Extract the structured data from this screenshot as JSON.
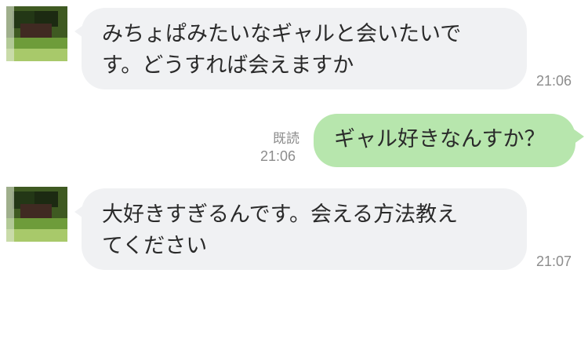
{
  "messages": [
    {
      "side": "incoming",
      "lines": [
        "みちょぱみたいなギャルと会いたいで",
        "す。どうすれば会えますか"
      ],
      "time": "21:06"
    },
    {
      "side": "outgoing",
      "text": "ギャル好きなんすか？",
      "read_label": "既読",
      "time": "21:06"
    },
    {
      "side": "incoming",
      "lines": [
        "大好きすぎるんです。会える方法教え",
        "てください"
      ],
      "time": "21:07"
    }
  ],
  "colors": {
    "incoming_bubble": "#f0f1f3",
    "outgoing_bubble": "#b7e6ad",
    "meta_text": "#8c8c8c"
  }
}
